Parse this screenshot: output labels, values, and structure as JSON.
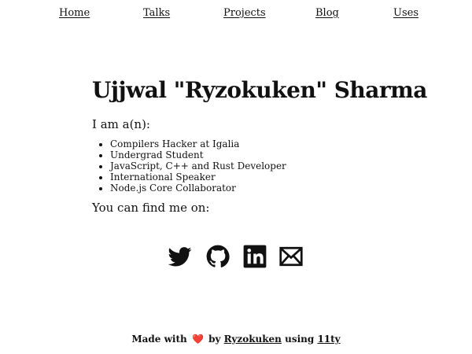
{
  "nav": {
    "items": [
      {
        "label": "Home"
      },
      {
        "label": "Talks"
      },
      {
        "label": "Projects"
      },
      {
        "label": "Blog"
      },
      {
        "label": "Uses"
      }
    ]
  },
  "main": {
    "title": "Ujjwal \"Ryzokuken\" Sharma",
    "intro": "I am a(n):",
    "roles": [
      "Compilers Hacker at Igalia",
      "Undergrad Student",
      "JavaScript, C++ and Rust Developer",
      "International Speaker",
      "Node.js Core Collaborator"
    ],
    "find_me": "You can find me on:"
  },
  "social": {
    "icons": [
      "twitter-icon",
      "github-icon",
      "linkedin-icon",
      "email-icon"
    ]
  },
  "footer": {
    "made_with": "Made with",
    "heart": "❤️",
    "by": "by",
    "author": "Ryzokuken",
    "using": "using",
    "tool": "11ty"
  },
  "colors": {
    "text": "#111111",
    "background": "#ffffff",
    "heart": "#e0334a"
  }
}
